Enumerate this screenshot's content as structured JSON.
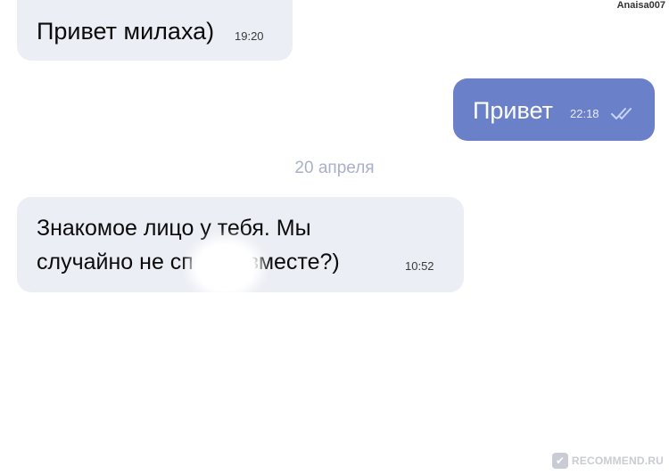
{
  "overlay": {
    "username": "Anaisa007",
    "watermark_text": "RECOMMEND.RU",
    "watermark_logo_glyph": "✔"
  },
  "messages": [
    {
      "direction": "incoming",
      "text": "Привет милаха)",
      "time": "19:20"
    },
    {
      "direction": "outgoing",
      "text": "Привет",
      "time": "22:18",
      "status_icon": "double-check-icon",
      "status": "read"
    },
    {
      "direction": "incoming",
      "line1": "Знакомое лицо у тебя. Мы",
      "line2": "случайно не сп",
      "line2_after_blur": "вместе?)",
      "time": "10:52"
    }
  ],
  "date_separator": "20 апреля",
  "colors": {
    "incoming_bubble": "#eceef5",
    "outgoing_bubble": "#6a80c9",
    "date_text": "#a9b0c8",
    "page_background": "#ffffff"
  }
}
